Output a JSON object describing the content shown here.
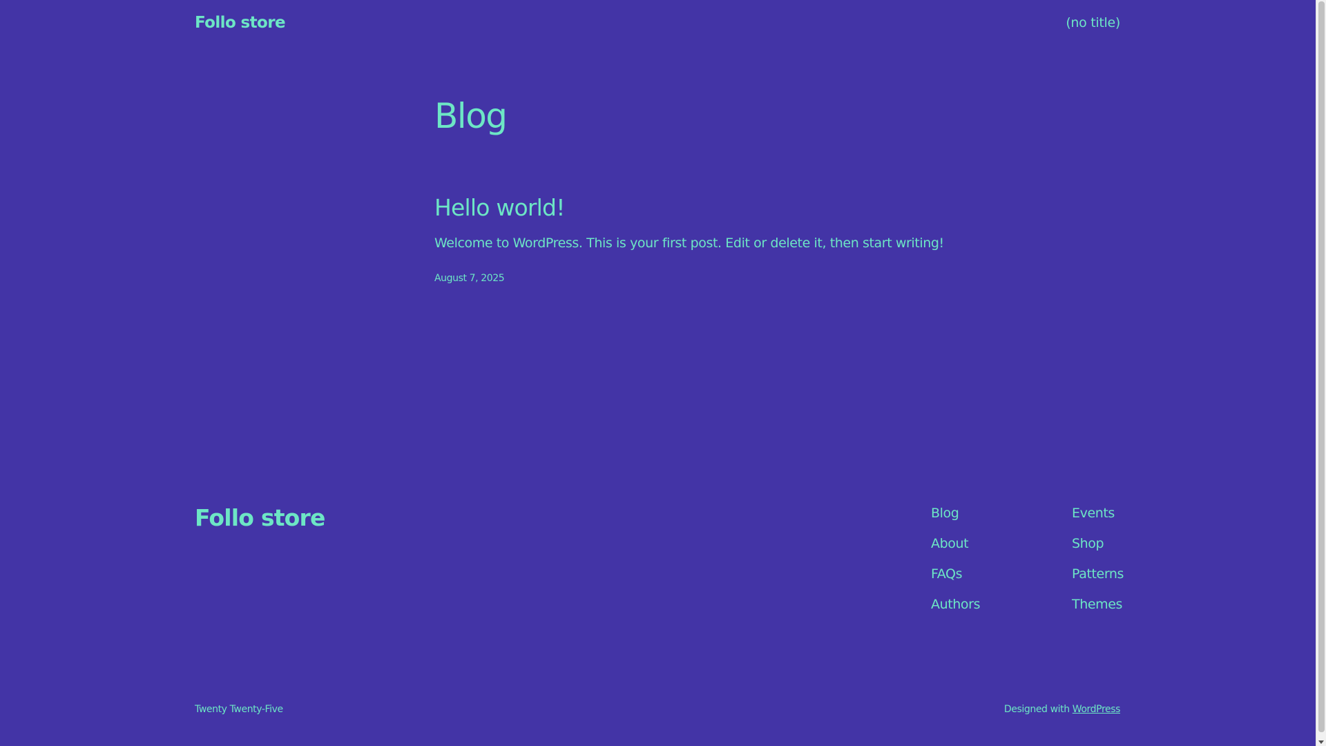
{
  "colors": {
    "background": "#4334a6",
    "text": "#6de6c5"
  },
  "header": {
    "site_title": "Follo store",
    "nav_link": "(no title)"
  },
  "main": {
    "page_title": "Blog",
    "posts": [
      {
        "title": "Hello world!",
        "excerpt": "Welcome to WordPress. This is your first post. Edit or delete it, then start writing!",
        "date": "August 7, 2025"
      }
    ]
  },
  "footer": {
    "site_title": "Follo store",
    "nav_col_1": [
      "Blog",
      "About",
      "FAQs",
      "Authors"
    ],
    "nav_col_2": [
      "Events",
      "Shop",
      "Patterns",
      "Themes"
    ],
    "theme_credit": "Twenty Twenty-Five",
    "designed_with_prefix": "Designed with",
    "designed_with_link": "WordPress"
  }
}
